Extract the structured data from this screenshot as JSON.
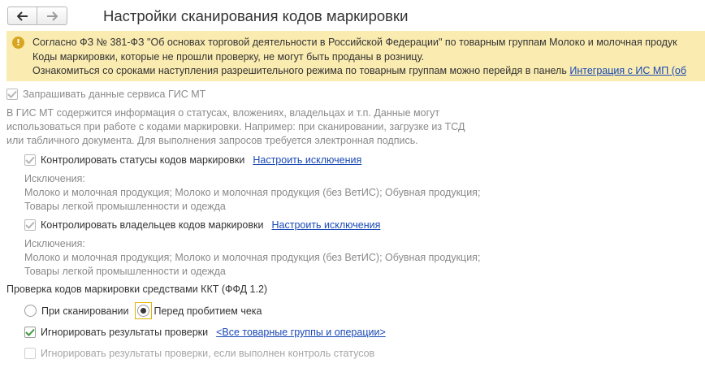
{
  "header": {
    "title": "Настройки сканирования кодов маркировки"
  },
  "banner": {
    "icon": "info-icon",
    "line1": "Согласно ФЗ № 381-ФЗ \"Об основах торговой деятельности в Российской Федерации\" по товарным группам Молоко и молочная продук",
    "line2": "Коды маркировки, которые не прошли проверку, не могут быть проданы в розницу.",
    "line3": "Ознакомиться со сроками наступления разрешительного режима по товарным группам можно перейдя в панель",
    "link": "Интеграция с ИС МП (об"
  },
  "gis": {
    "checkbox_label": "Запрашивать данные сервиса ГИС МТ",
    "description_lines": [
      "В ГИС МТ содержится информация о статусах, вложениях, владельцах и т.п. Данные могут",
      "использоваться при работе с кодами маркировки. Например: при сканировании, загрузке из ТСД",
      "или табличного документа. Для выполнения запросов требуется электронная подпись."
    ]
  },
  "status_control": {
    "checkbox_label": "Контролировать статусы кодов маркировки",
    "link": "Настроить исключения",
    "exceptions_label": "Исключения:",
    "exceptions_line1": "Молоко и молочная продукция; Молоко и молочная продукция (без ВетИС); Обувная продукция;",
    "exceptions_line2": "Товары легкой промышленности и одежда"
  },
  "owner_control": {
    "checkbox_label": "Контролировать владельцев кодов маркировки",
    "link": "Настроить исключения",
    "exceptions_label": "Исключения:",
    "exceptions_line1": "Молоко и молочная продукция; Молоко и молочная продукция (без ВетИС); Обувная продукция;",
    "exceptions_line2": "Товары легкой промышленности и одежда"
  },
  "kkt_check": {
    "heading": "Проверка кодов маркировки средствами ККТ (ФФД 1.2)",
    "radio_scan_label": "При сканировании",
    "radio_before_label": "Перед пробитием чека",
    "selected": "Перед пробитием чека",
    "ignore_label": "Игнорировать результаты проверки",
    "ignore_checked": true,
    "ignore_link": "<Все товарные группы и операции>",
    "ignore_status_label": "Игнорировать результаты проверки, если выполнен контроль статусов",
    "ignore_status_checked": false
  },
  "colors": {
    "banner_bg": "#faebb0",
    "link": "#1a49b5",
    "check_green": "#3d9a3d",
    "focus_yellow": "#e3b100"
  }
}
